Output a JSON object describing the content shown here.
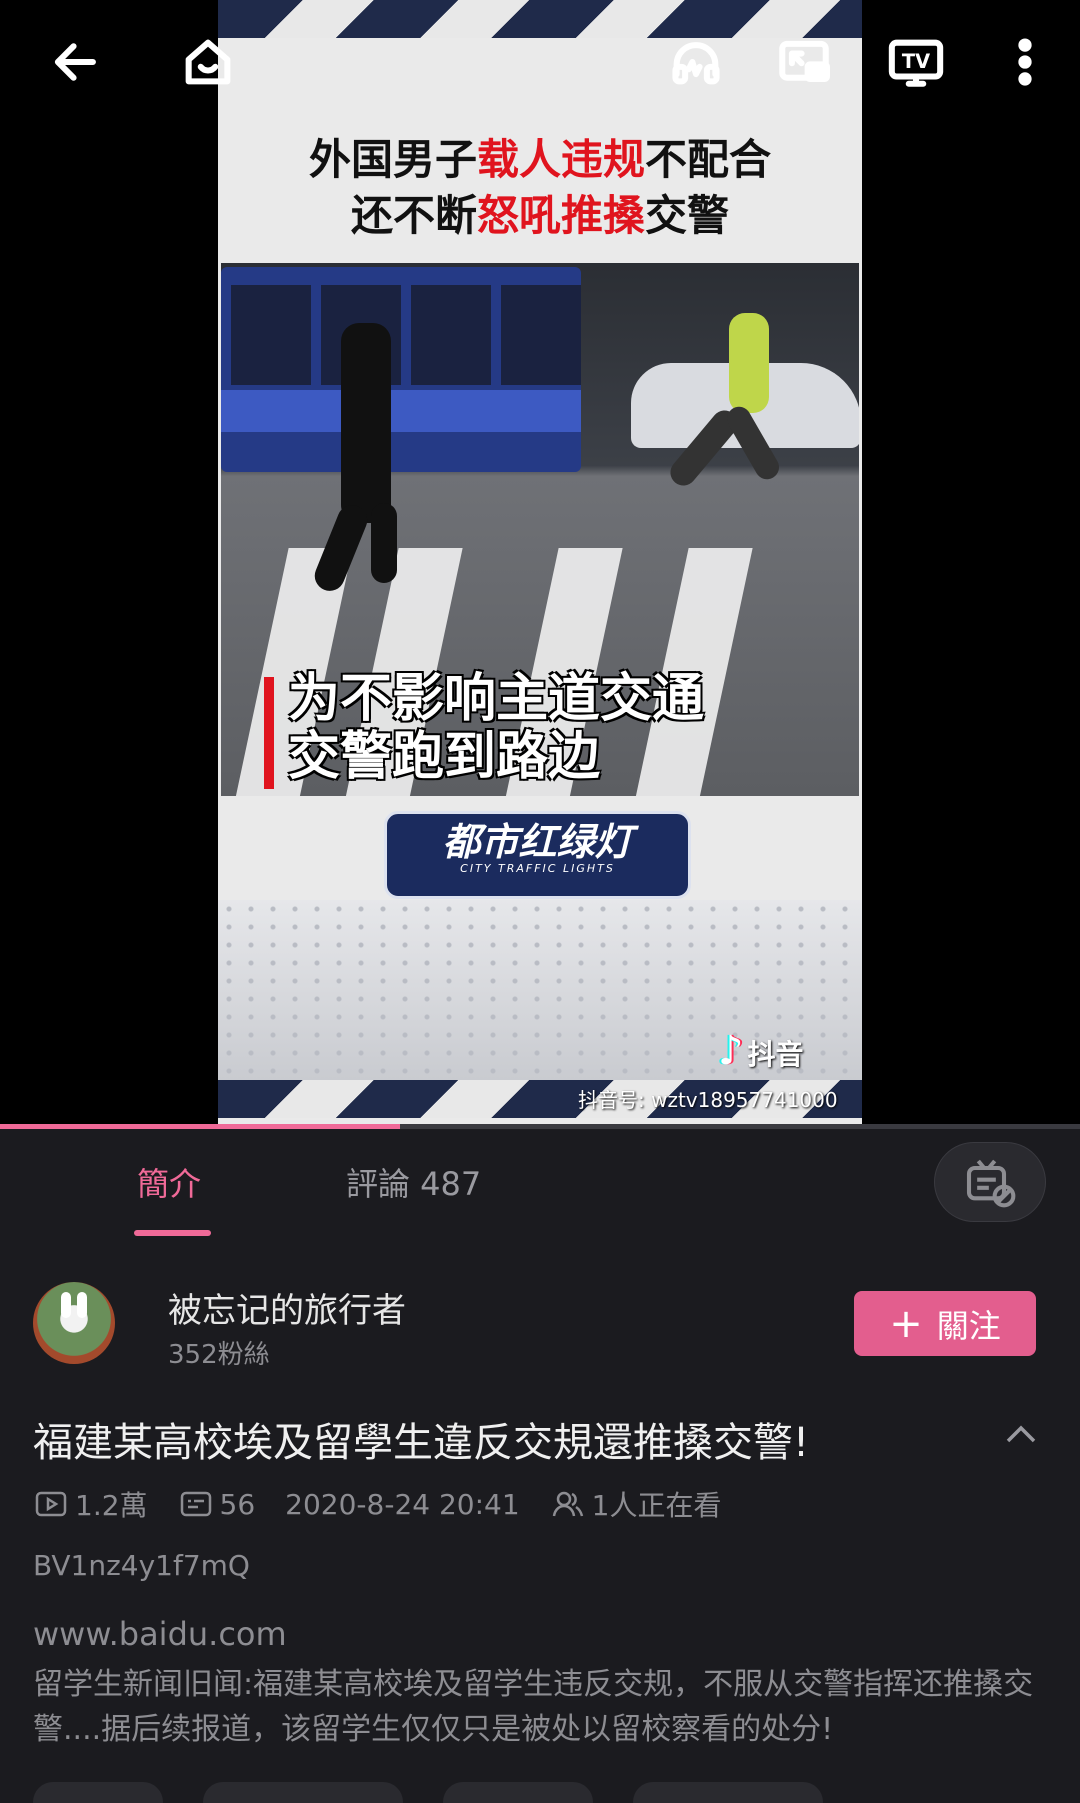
{
  "topbar": {
    "back_icon": "back-arrow-icon",
    "home_icon": "home-icon",
    "audio_icon": "headphones-icon",
    "pip_icon": "picture-in-picture-icon",
    "cast_label": "TV",
    "more_icon": "more-vertical-icon"
  },
  "video": {
    "headline_line1_pre": "外国男子",
    "headline_line1_red": "载人违规",
    "headline_line1_post": "不配合",
    "headline_line2_pre": "还不断",
    "headline_line2_red": "怒吼推搡",
    "headline_line2_post": "交警",
    "caption_line1": "为不影响主道交通",
    "caption_line2": "交警跑到路边",
    "logo_text": "都市红绿灯",
    "logo_sub": "CITY TRAFFIC LIGHTS",
    "tiktok_label": "抖音",
    "tiktok_id": "抖音号: wztv18957741000",
    "progress": 0.37
  },
  "tabs": {
    "intro": "簡介",
    "comments": "評論 487"
  },
  "uploader": {
    "name": "被忘记的旅行者",
    "fans": "352粉絲",
    "follow_label": "關注"
  },
  "video_info": {
    "title": "福建某高校埃及留學生違反交規還推搡交警!",
    "views": "1.2萬",
    "danmaku": "56",
    "date": "2020-8-24 20:41",
    "watching": "1人正在看",
    "bvid": "BV1nz4y1f7mQ",
    "source_link": "www.baidu.com",
    "description": "留学生新闻旧闻:福建某高校埃及留学生违反交规，不服从交警指挥还推搡交警....据后续报道，该留学生仅仅只是被处以留校察看的处分!"
  },
  "colors": {
    "accent": "#f06a98",
    "follow_button": "#e35e8e",
    "background": "#1b1b1f"
  }
}
